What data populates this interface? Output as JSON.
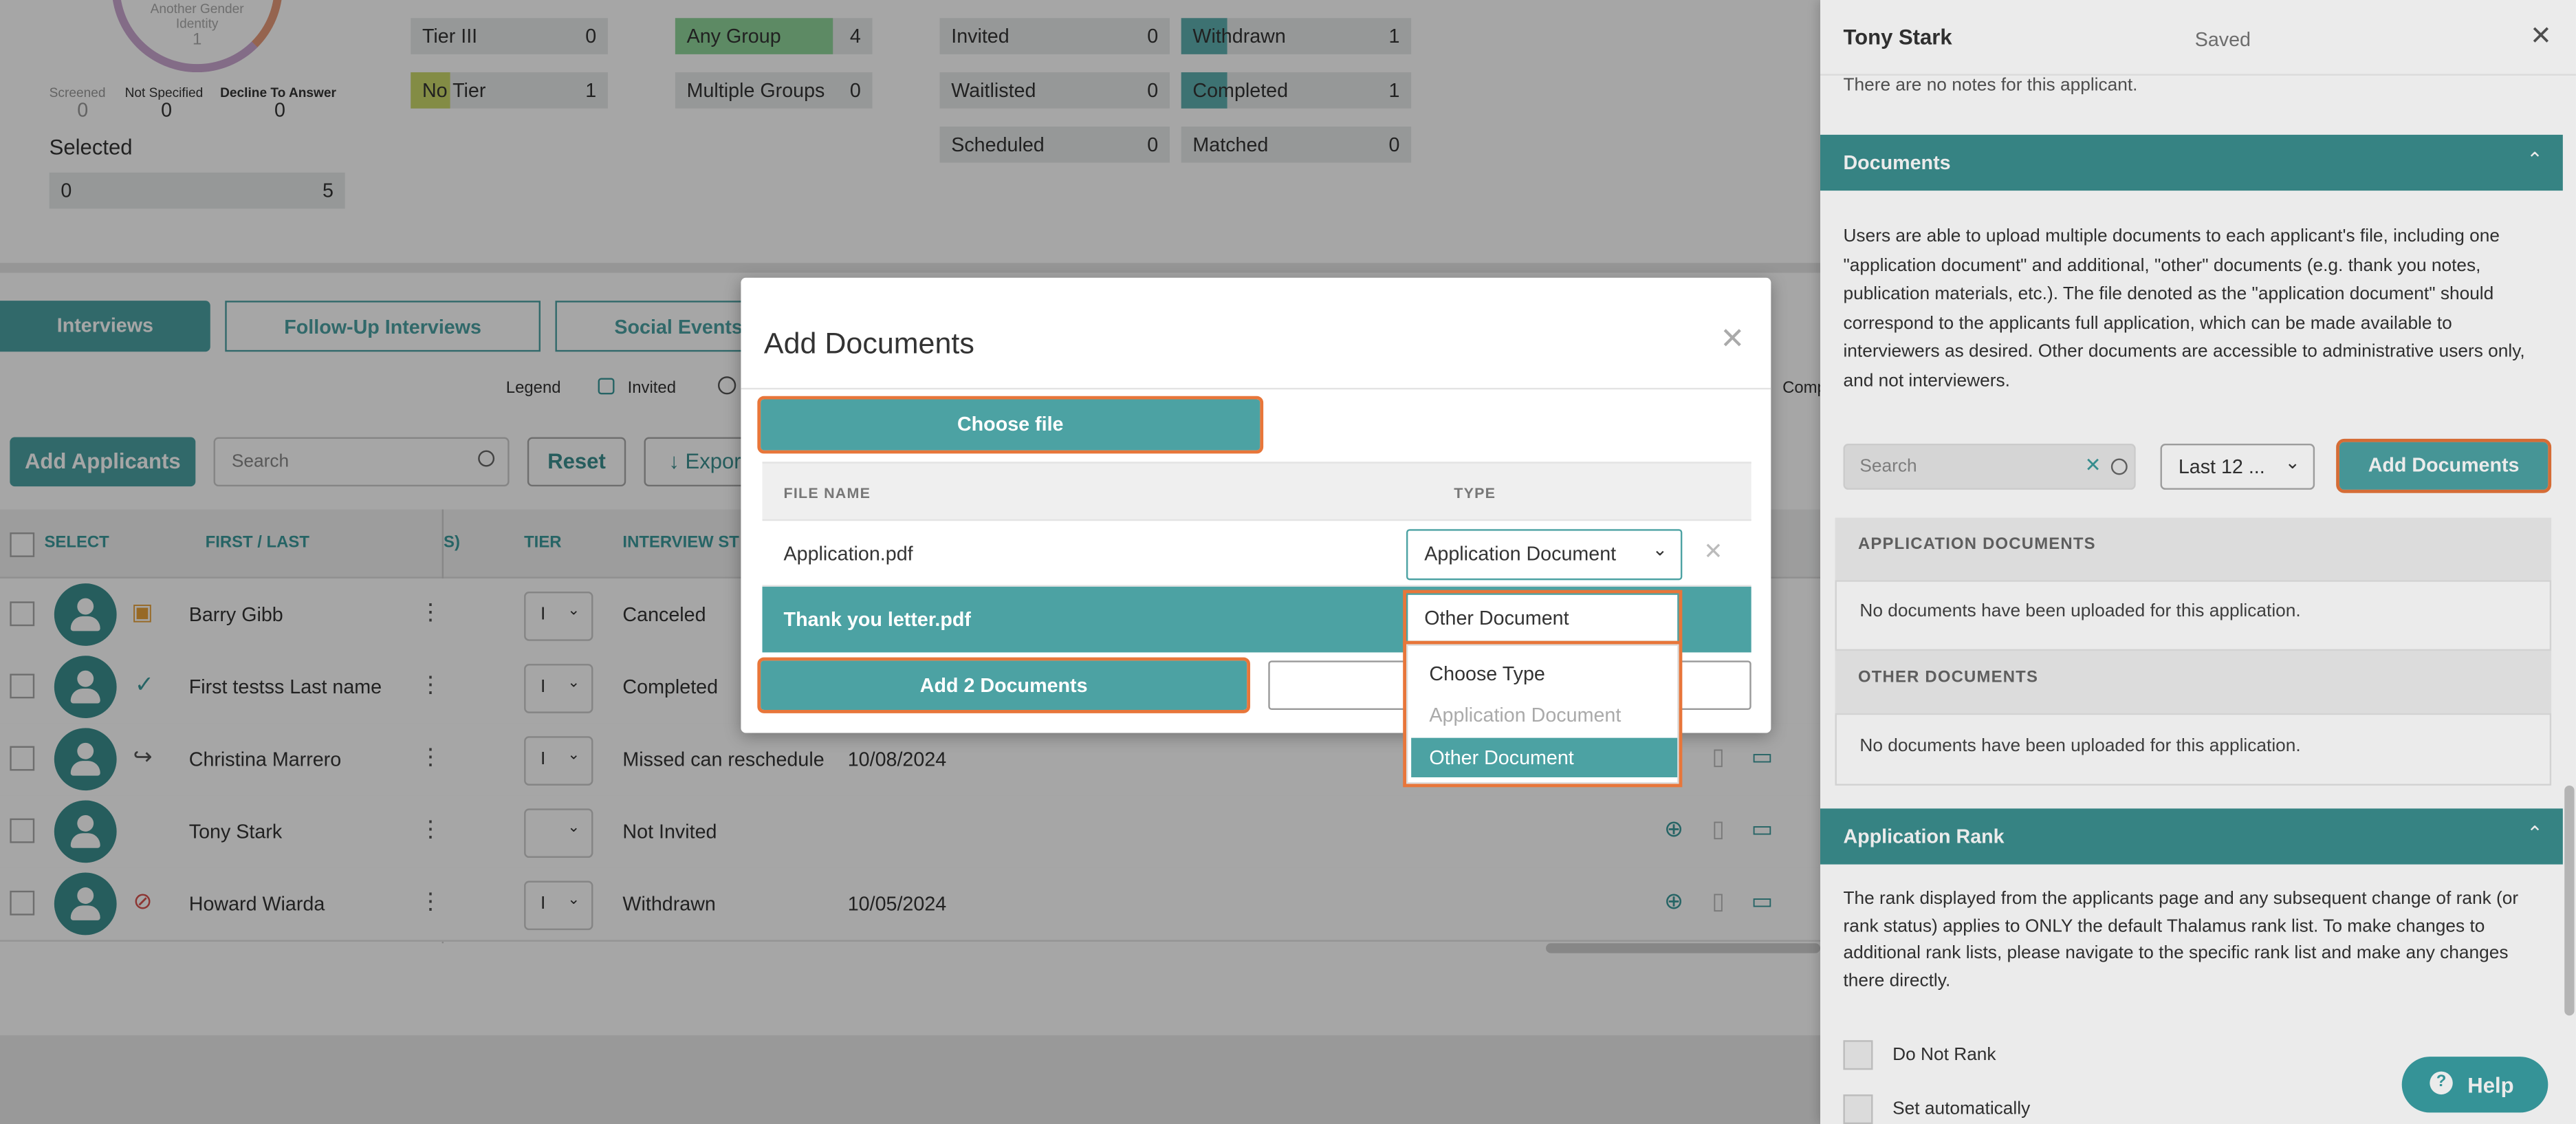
{
  "stats": {
    "donut_label": "Another Gender Identity",
    "donut_value": "1",
    "screened_label": "Screened",
    "screened_value": "0",
    "not_specified_label": "Not Specified",
    "not_specified_value": "0",
    "decline_label": "Decline To Answer",
    "decline_value": "0",
    "selected_title": "Selected",
    "selected_left": "0",
    "selected_right": "5",
    "tiers": [
      {
        "label": "Tier III",
        "value": "0"
      },
      {
        "label": "No Tier",
        "value": "1"
      }
    ],
    "groups": [
      {
        "label": "Any Group",
        "value": "4"
      },
      {
        "label": "Multiple Groups",
        "value": "0"
      }
    ],
    "status_a": [
      {
        "label": "Invited",
        "value": "0"
      },
      {
        "label": "Waitlisted",
        "value": "0"
      },
      {
        "label": "Scheduled",
        "value": "0"
      }
    ],
    "status_b": [
      {
        "label": "Withdrawn",
        "value": "1"
      },
      {
        "label": "Completed",
        "value": "1"
      },
      {
        "label": "Matched",
        "value": "0"
      }
    ]
  },
  "tabs": [
    "Interviews",
    "Follow-Up Interviews",
    "Social Events"
  ],
  "legend": {
    "label": "Legend",
    "invited": "Invited",
    "comp": "Comp"
  },
  "toolbar": {
    "add_applicants": "Add Applicants",
    "search_placeholder": "Search",
    "reset": "Reset",
    "export": "Export"
  },
  "table": {
    "headers": {
      "select": "SELECT",
      "first_last": "FIRST / LAST",
      "s": "S)",
      "tier": "TIER",
      "interview_status": "INTERVIEW ST"
    },
    "rows": [
      {
        "name": "Barry Gibb",
        "tier": "I",
        "status": "Canceled",
        "date": ""
      },
      {
        "name": "First testss Last name",
        "tier": "I",
        "status": "Completed",
        "date": ""
      },
      {
        "name": "Christina Marrero",
        "tier": "I",
        "status": "Missed can reschedule",
        "date": "10/08/2024"
      },
      {
        "name": "Tony Stark",
        "tier": "",
        "status": "Not Invited",
        "date": ""
      },
      {
        "name": "Howard Wiarda",
        "tier": "I",
        "status": "Withdrawn",
        "date": "10/05/2024"
      }
    ]
  },
  "modal": {
    "title": "Add Documents",
    "choose_file": "Choose file",
    "col_file_name": "FILE NAME",
    "col_type": "TYPE",
    "files": [
      {
        "name": "Application.pdf",
        "type": "Application Document"
      },
      {
        "name": "Thank you letter.pdf",
        "type": "Other Document"
      }
    ],
    "add_button": "Add 2 Documents",
    "dropdown_options": [
      "Choose Type",
      "Application Document",
      "Other Document"
    ]
  },
  "panel": {
    "name": "Tony Stark",
    "saved": "Saved",
    "no_notes": "There are no notes for this applicant.",
    "documents_title": "Documents",
    "documents_desc": "Users are able to upload multiple documents to each applicant's file, including one \"application document\" and additional, \"other\" documents (e.g. thank you notes, publication materials, etc.). The file denoted as the \"application document\" should correspond to the applicants full application, which can be made available to interviewers as desired. Other documents are accessible to administrative users only, and not interviewers.",
    "search_placeholder": "Search",
    "range": "Last 12 ...",
    "add_documents": "Add Documents",
    "app_docs_header": "APPLICATION DOCUMENTS",
    "app_docs_empty": "No documents have been uploaded for this application.",
    "other_docs_header": "OTHER DOCUMENTS",
    "other_docs_empty": "No documents have been uploaded for this application.",
    "rank_title": "Application Rank",
    "rank_desc": "The rank displayed from the applicants page and any subsequent change of rank (or rank status) applies to ONLY the default Thalamus rank list. To make changes to additional rank lists, please navigate to the specific rank list and make any changes there directly.",
    "do_not_rank": "Do Not Rank",
    "set_auto": "Set automatically",
    "help": "Help"
  }
}
